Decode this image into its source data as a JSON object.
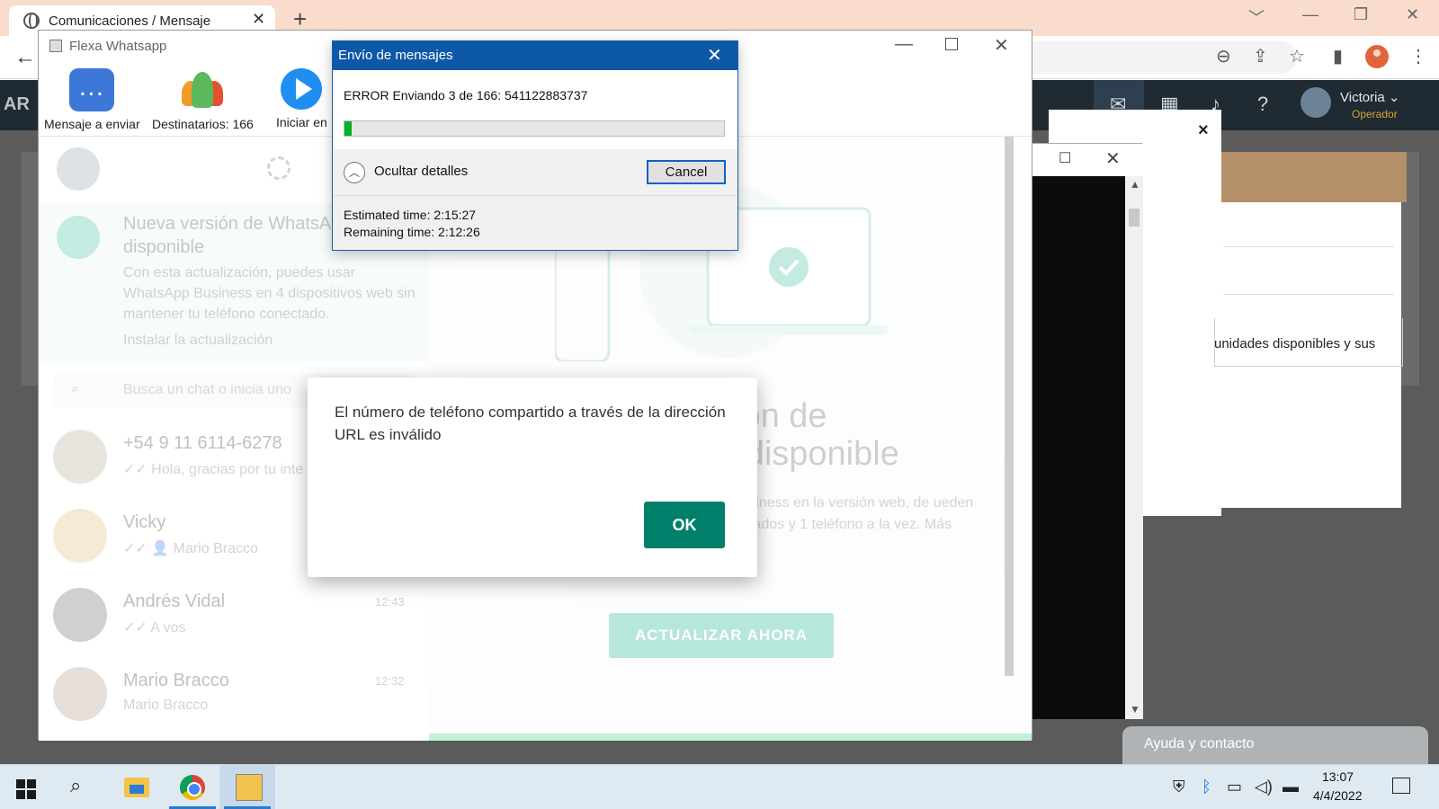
{
  "browser": {
    "tab_title": "Comunicaciones / Mensaje",
    "tab_close": "✕",
    "new_tab": "+",
    "back": "←",
    "minimize": "﹀",
    "win_min": "—",
    "win_restore": "❐",
    "win_close": "✕"
  },
  "webapp": {
    "logo": "AR",
    "user_name": "Victoria",
    "user_chevron": "⌄",
    "user_role": "Operador",
    "modal_close": "×",
    "partial_text": "unidades disponibles y sus",
    "help": "Ayuda y contacto"
  },
  "console": {
    "max": "☐",
    "close": "✕",
    "scroll_up": "▲",
    "scroll_down": "▼"
  },
  "flexa": {
    "title": "Flexa Whatsapp",
    "min": "—",
    "close": "✕",
    "ribbon": {
      "message": "Mensaje a enviar",
      "recipients": "Destinatarios: 166",
      "start": "Iniciar en"
    }
  },
  "whatsapp": {
    "update_title": "Nueva versión de WhatsApp disponible",
    "update_desc": "Con esta actualización, puedes usar WhatsApp Business en 4 dispositivos web sin mantener tu teléfono conectado.",
    "update_link": "Instalar la actualización",
    "search_placeholder": "Busca un chat o inicia uno",
    "chats": [
      {
        "name": "+54 9 11 6114-6278",
        "sub": "✓✓ Hola, gracias por tu inte",
        "time": ""
      },
      {
        "name": "Vicky",
        "sub": "✓✓ 👤 Mario Bracco",
        "time": ""
      },
      {
        "name": "Andrés Vidal",
        "sub": "✓✓ A vos",
        "time": "12:43"
      },
      {
        "name": "Mario Bracco",
        "sub": "Mario Bracco",
        "time": "12:32"
      }
    ],
    "big_title": "sión de\no disponible",
    "big_desc": "a no tendrá que permanecer usiness en la versión web, de ueden usar hasta 4 dispositivos vinculados y 1 teléfono a la vez. Más información",
    "update_button": "ACTUALIZAR AHORA"
  },
  "send_dialog": {
    "title": "Envío de mensajes",
    "close": "✕",
    "status": "ERROR Enviando 3 de 166: 541122883737",
    "progress_fraction": 0.018,
    "progress_color": "#06b025",
    "details_chevron": "︿",
    "details_label": "Ocultar detalles",
    "cancel": "Cancel",
    "estimated": "Estimated time: 2:15:27",
    "remaining": "Remaining time: 2:12:26"
  },
  "error_dialog": {
    "message": "El número de teléfono compartido a través de la dirección URL es inválido",
    "ok": "OK",
    "ok_color": "#00806a"
  },
  "taskbar": {
    "search": "⌕",
    "clock_time": "13:07",
    "clock_date": "4/4/2022"
  },
  "icons": [
    "globe-icon",
    "search-icon",
    "star-icon",
    "zoom-icon",
    "share-icon",
    "menu-icon",
    "mail-icon",
    "calendar-icon",
    "bell-icon",
    "help-icon",
    "shield-icon",
    "bluetooth-icon",
    "network-icon",
    "volume-icon",
    "battery-icon",
    "notification-icon"
  ]
}
